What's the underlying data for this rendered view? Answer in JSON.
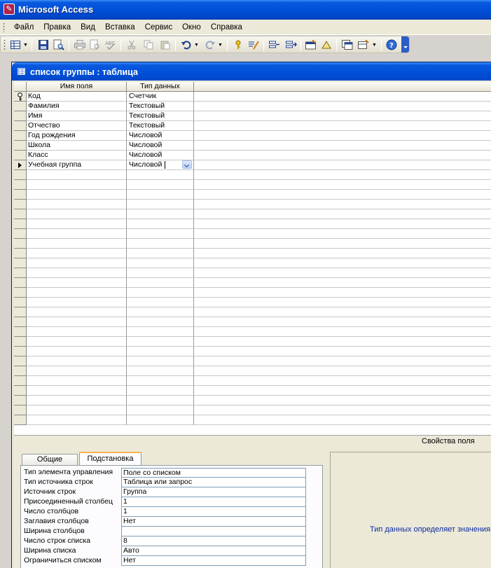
{
  "window": {
    "title": "Microsoft Access"
  },
  "menu": [
    "Файл",
    "Правка",
    "Вид",
    "Вставка",
    "Сервис",
    "Окно",
    "Справка"
  ],
  "table_window": {
    "title": "список группы : таблица",
    "columns": {
      "field_name": "Имя поля",
      "data_type": "Тип данных"
    },
    "fields": [
      {
        "name": "Код",
        "type": "Счетчик",
        "primary_key": true
      },
      {
        "name": "Фамилия",
        "type": "Текстовый"
      },
      {
        "name": "Имя",
        "type": "Текстовый"
      },
      {
        "name": "Отчество",
        "type": "Текстовый"
      },
      {
        "name": "Год рождения",
        "type": "Числовой"
      },
      {
        "name": "Школа",
        "type": "Числовой"
      },
      {
        "name": "Класс",
        "type": "Числовой"
      },
      {
        "name": "Учебная группа",
        "type": "Числовой",
        "current": true
      }
    ]
  },
  "field_properties": {
    "header": "Свойства поля",
    "tabs": {
      "general": "Общие",
      "lookup": "Подстановка"
    },
    "active_tab": "lookup",
    "lookup_properties": [
      {
        "label": "Тип элемента управления",
        "value": "Поле со списком"
      },
      {
        "label": "Тип источника строк",
        "value": "Таблица или запрос"
      },
      {
        "label": "Источник строк",
        "value": " Группа"
      },
      {
        "label": "Присоединенный столбец",
        "value": "1"
      },
      {
        "label": "Число столбцов",
        "value": "1"
      },
      {
        "label": "Заглавия столбцов",
        "value": "Нет"
      },
      {
        "label": "Ширина столбцов",
        "value": ""
      },
      {
        "label": "Число строк списка",
        "value": "8"
      },
      {
        "label": "Ширина списка",
        "value": "Авто"
      },
      {
        "label": "Ограничиться списком",
        "value": "Нет"
      }
    ],
    "help_text": "Тип данных определяет значения"
  },
  "toolbar_icons": [
    "view-icon",
    "save-icon",
    "print-preview-icon",
    "print-icon",
    "spelling-icon",
    "cut-icon",
    "copy-icon",
    "paste-icon",
    "undo-icon",
    "redo-icon",
    "primary-key-icon",
    "builder-icon",
    "insert-rows-icon",
    "delete-rows-icon",
    "properties-icon",
    "build-icon",
    "database-window-icon",
    "new-object-icon",
    "help-icon"
  ]
}
